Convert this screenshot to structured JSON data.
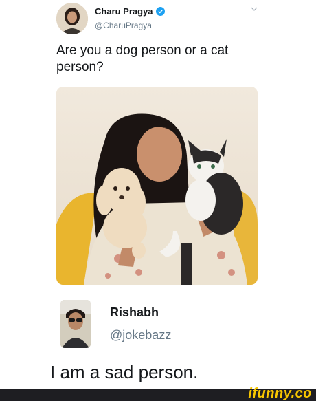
{
  "tweet_top": {
    "author_name": "Charu Pragya",
    "author_handle": "@CharuPragya",
    "text": "Are you a dog person or a cat person?",
    "verified_icon": "verified-badge-icon",
    "menu_icon": "chevron-down-icon",
    "image_description": "photo"
  },
  "tweet_reply": {
    "author_name": "Rishabh",
    "author_handle": "@jokebazz",
    "text": "I am a sad person."
  },
  "watermark": {
    "brand": "ifunny.co"
  },
  "colors": {
    "verified": "#1da1f2",
    "handle": "#657786",
    "footer_bg": "#1e1e22",
    "brand": "#f7c600"
  }
}
